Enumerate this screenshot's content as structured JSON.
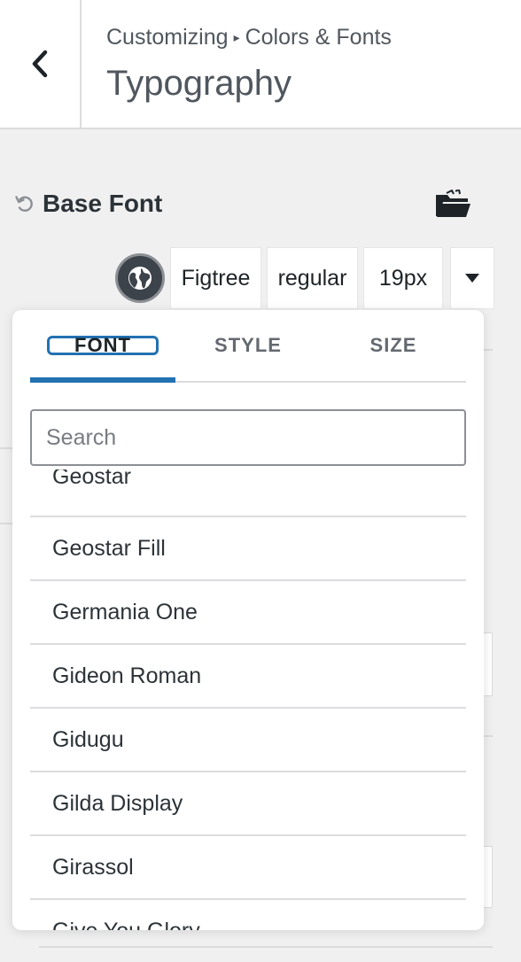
{
  "header": {
    "breadcrumb_root": "Customizing",
    "breadcrumb_separator": "▸",
    "breadcrumb_section": "Colors & Fonts",
    "title": "Typography"
  },
  "control": {
    "title": "Base Font"
  },
  "selector": {
    "family": "Figtree",
    "style": "regular",
    "size": "19px"
  },
  "panel": {
    "tabs": [
      {
        "label": "FONT"
      },
      {
        "label": "STYLE"
      },
      {
        "label": "SIZE"
      }
    ],
    "search_placeholder": "Search",
    "fonts": [
      "Geostar",
      "Geostar Fill",
      "Germania One",
      "Gideon Roman",
      "Gidugu",
      "Gilda Display",
      "Girassol",
      "Give You Glory"
    ]
  },
  "colors": {
    "accent": "#2271b1",
    "text": "#1d2327",
    "muted": "#50575e",
    "background": "#f0f0f1"
  }
}
